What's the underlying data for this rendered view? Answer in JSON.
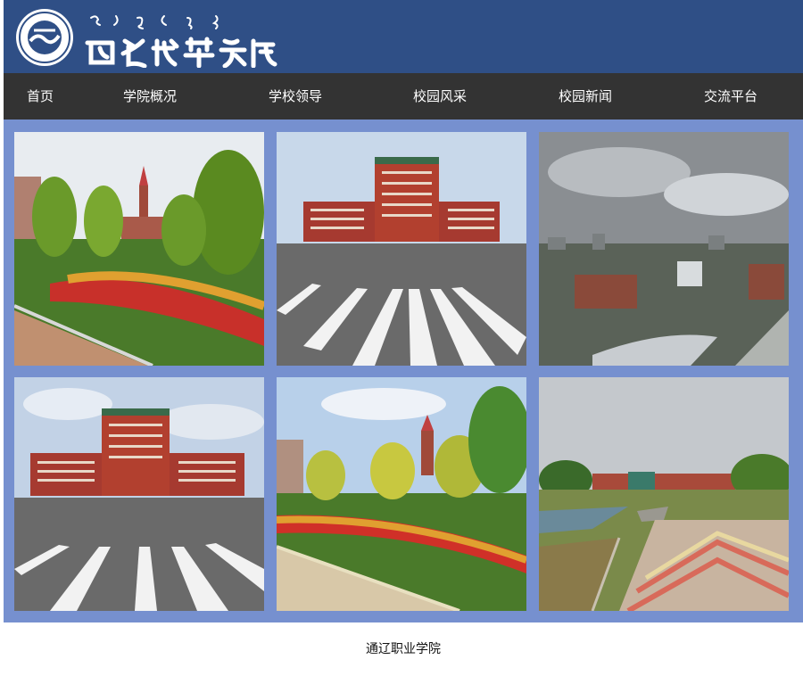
{
  "header": {
    "logo_icon": "college-emblem-icon",
    "brand_icon": "college-calligraphy-wordmark"
  },
  "nav": {
    "items": [
      {
        "label": "首页"
      },
      {
        "label": "学院概况"
      },
      {
        "label": "学校领导"
      },
      {
        "label": "校园风采"
      },
      {
        "label": "校园新闻"
      },
      {
        "label": "交流平台"
      }
    ]
  },
  "gallery": {
    "photos": [
      {
        "subject": "campus-garden-icon"
      },
      {
        "subject": "main-building-icon"
      },
      {
        "subject": "campus-aerial-icon"
      },
      {
        "subject": "main-building-icon"
      },
      {
        "subject": "campus-garden-icon"
      },
      {
        "subject": "campus-plaza-icon"
      }
    ]
  },
  "footer": {
    "text": "通辽职业学院"
  },
  "colors": {
    "header_bg": "#2f4f86",
    "nav_bg": "#333333",
    "gallery_bg": "#7690cf"
  }
}
